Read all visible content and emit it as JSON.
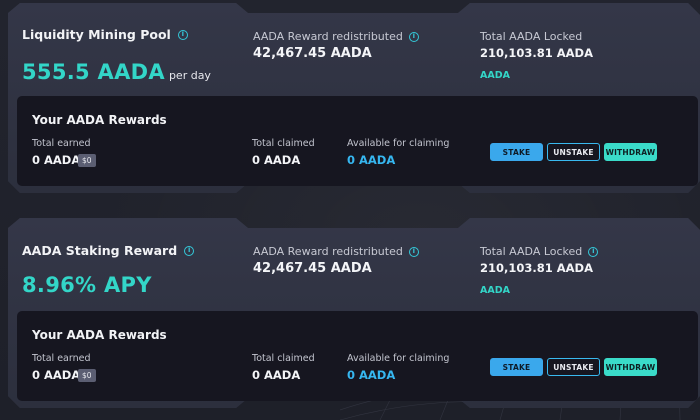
{
  "pools": [
    {
      "title": "Liquidity Mining Pool",
      "headline_value": "555.5 AADA",
      "headline_suffix": "per day",
      "reward_redistributed_label": "AADA Reward redistributed",
      "reward_redistributed_value": "42,467.45 AADA",
      "total_locked_label": "Total AADA Locked",
      "total_locked_value": "210,103.81 AADA",
      "token_link": "AADA",
      "rewards": {
        "title": "Your AADA Rewards",
        "total_earned_label": "Total earned",
        "total_earned_value": "0 AADA",
        "total_earned_usd": "$0",
        "total_claimed_label": "Total claimed",
        "total_claimed_value": "0 AADA",
        "available_label": "Available for claiming",
        "available_value": "0 AADA",
        "stake_label": "STAKE",
        "unstake_label": "UNSTAKE",
        "withdraw_label": "WITHDRAW"
      }
    },
    {
      "title": "AADA Staking Reward",
      "headline_value": "8.96% APY",
      "headline_suffix": "",
      "reward_redistributed_label": "AADA Reward redistributed",
      "reward_redistributed_value": "42,467.45 AADA",
      "total_locked_label": "Total AADA Locked",
      "total_locked_value": "210,103.81 AADA",
      "token_link": "AADA",
      "rewards": {
        "title": "Your AADA Rewards",
        "total_earned_label": "Total earned",
        "total_earned_value": "0 AADA",
        "total_earned_usd": "$0",
        "total_claimed_label": "Total claimed",
        "total_claimed_value": "0 AADA",
        "available_label": "Available for claiming",
        "available_value": "0 AADA",
        "stake_label": "STAKE",
        "unstake_label": "UNSTAKE",
        "withdraw_label": "WITHDRAW"
      }
    }
  ],
  "info_icon_glyph": "i",
  "colors": {
    "accent_teal": "#33d6c8",
    "accent_blue": "#36b7f0",
    "panel": "#303342",
    "rewards_bg": "#161620",
    "page_bg": "#20222c"
  }
}
